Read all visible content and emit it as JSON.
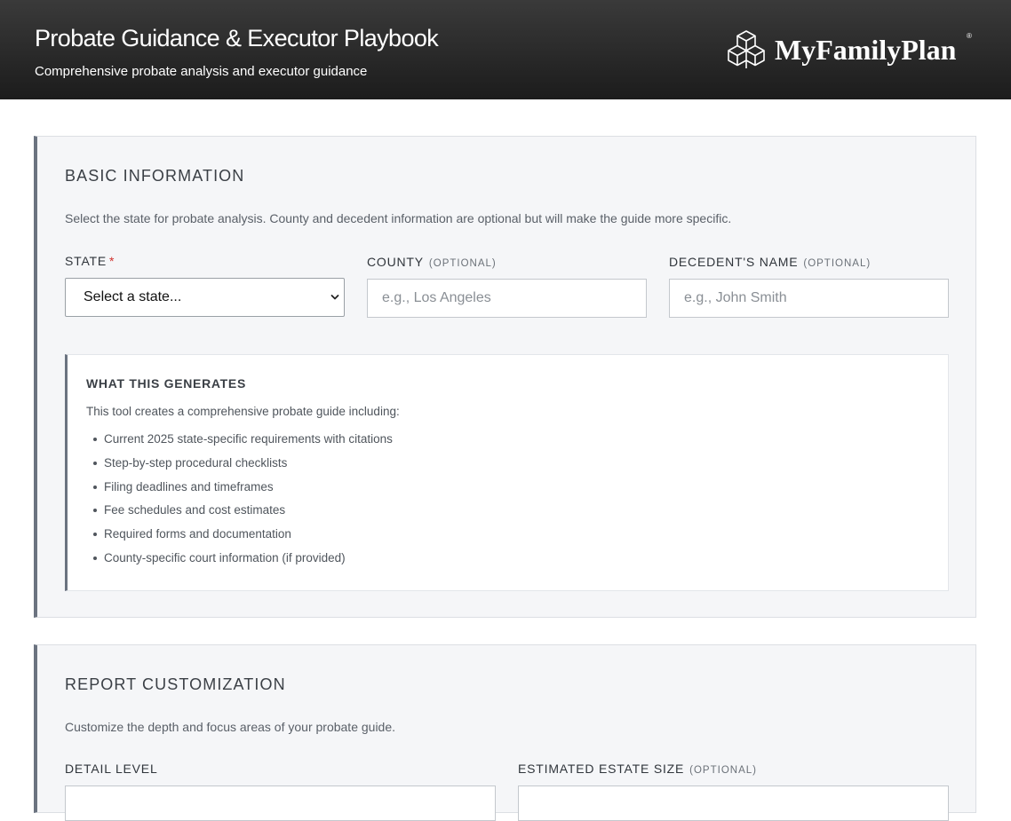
{
  "header": {
    "title": "Probate Guidance & Executor Playbook",
    "subtitle": "Comprehensive probate analysis and executor guidance",
    "logo_text": "MyFamilyPlan",
    "logo_mark": "®",
    "logo_icon": "cube-cluster-icon"
  },
  "basic_info": {
    "title": "BASIC INFORMATION",
    "description": "Select the state for probate analysis. County and decedent information are optional but will make the guide more specific.",
    "state": {
      "label": "STATE",
      "required_mark": "*",
      "selected": "Select a state..."
    },
    "county": {
      "label": "COUNTY",
      "optional": "(OPTIONAL)",
      "placeholder": "e.g., Los Angeles"
    },
    "decedent": {
      "label": "DECEDENT'S NAME",
      "optional": "(OPTIONAL)",
      "placeholder": "e.g., John Smith"
    },
    "generates": {
      "title": "WHAT THIS GENERATES",
      "description": "This tool creates a comprehensive probate guide including:",
      "items": [
        "Current 2025 state-specific requirements with citations",
        "Step-by-step procedural checklists",
        "Filing deadlines and timeframes",
        "Fee schedules and cost estimates",
        "Required forms and documentation",
        "County-specific court information (if provided)"
      ]
    }
  },
  "report": {
    "title": "REPORT CUSTOMIZATION",
    "description": "Customize the depth and focus areas of your probate guide.",
    "detail_level": {
      "label": "DETAIL LEVEL"
    },
    "estate_size": {
      "label": "ESTIMATED ESTATE SIZE",
      "optional": "(OPTIONAL)"
    }
  },
  "colors": {
    "header_bg": "#1c1c1c",
    "section_bg": "#f5f6f8",
    "accent_border": "#6b7380",
    "required": "#d0312d"
  }
}
